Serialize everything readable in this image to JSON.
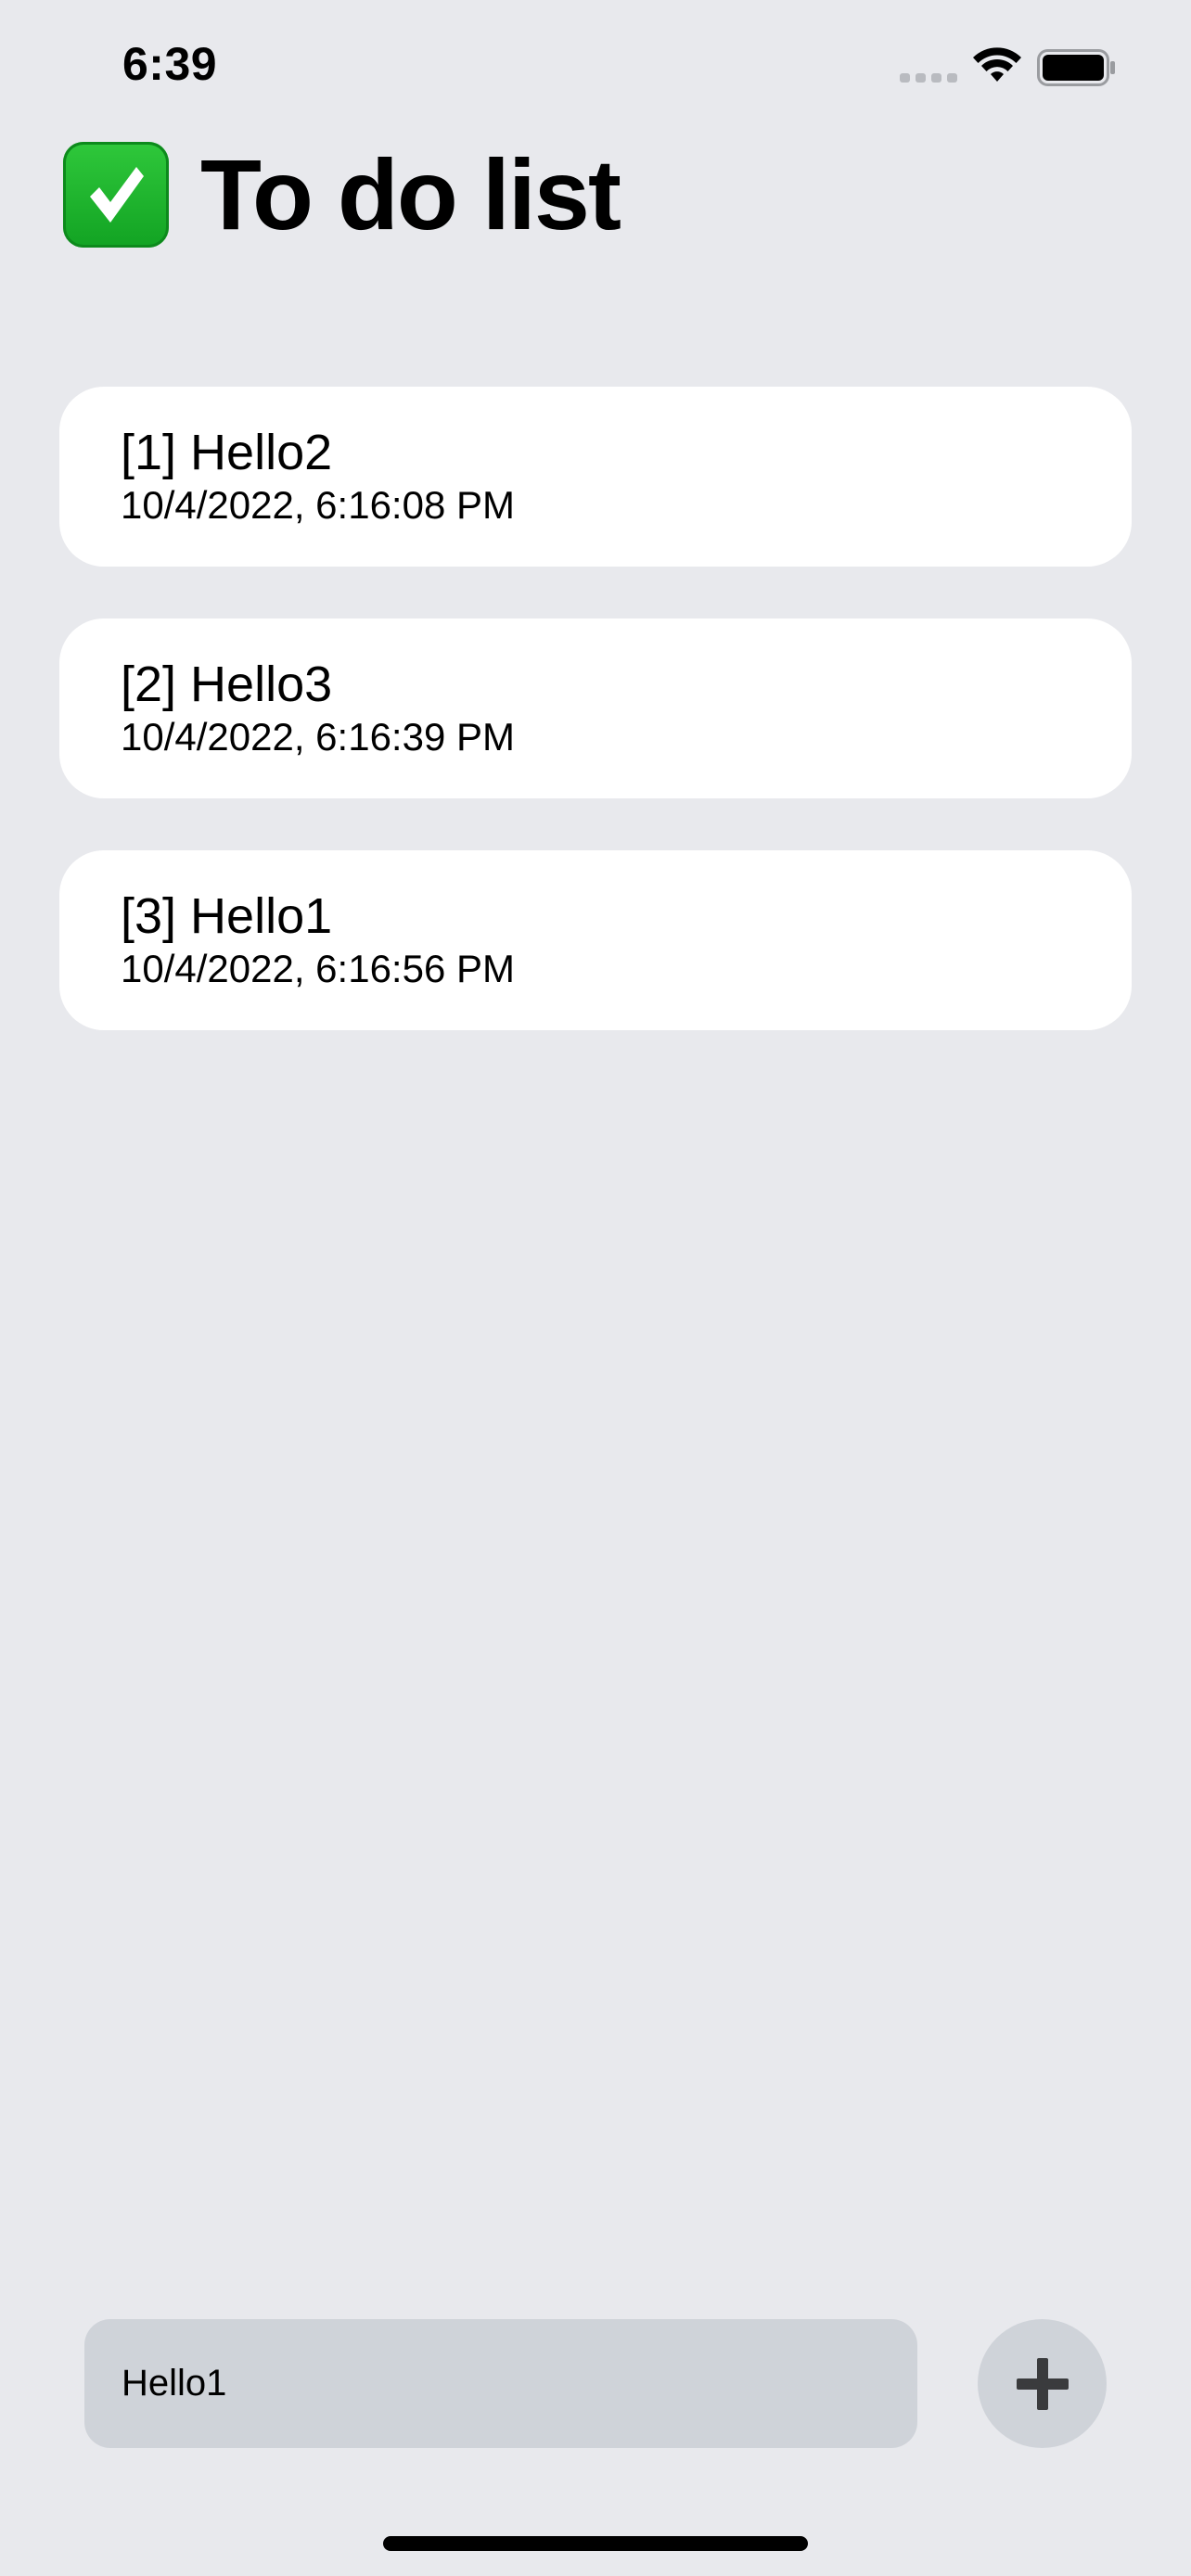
{
  "status_bar": {
    "time": "6:39"
  },
  "header": {
    "title": "To do list"
  },
  "todos": [
    {
      "title": "[1] Hello2",
      "timestamp": "10/4/2022, 6:16:08 PM"
    },
    {
      "title": "[2] Hello3",
      "timestamp": "10/4/2022, 6:16:39 PM"
    },
    {
      "title": "[3] Hello1",
      "timestamp": "10/4/2022, 6:16:56 PM"
    }
  ],
  "input": {
    "value": "Hello1"
  },
  "icons": {
    "header": "check-mark-icon",
    "add": "plus-icon",
    "wifi": "wifi-icon",
    "battery": "battery-icon",
    "signal": "cellular-signal-icon"
  },
  "colors": {
    "background": "#e8e9ed",
    "card": "#ffffff",
    "input_background": "#cfd3d9",
    "check_green": "#1cb52d"
  }
}
